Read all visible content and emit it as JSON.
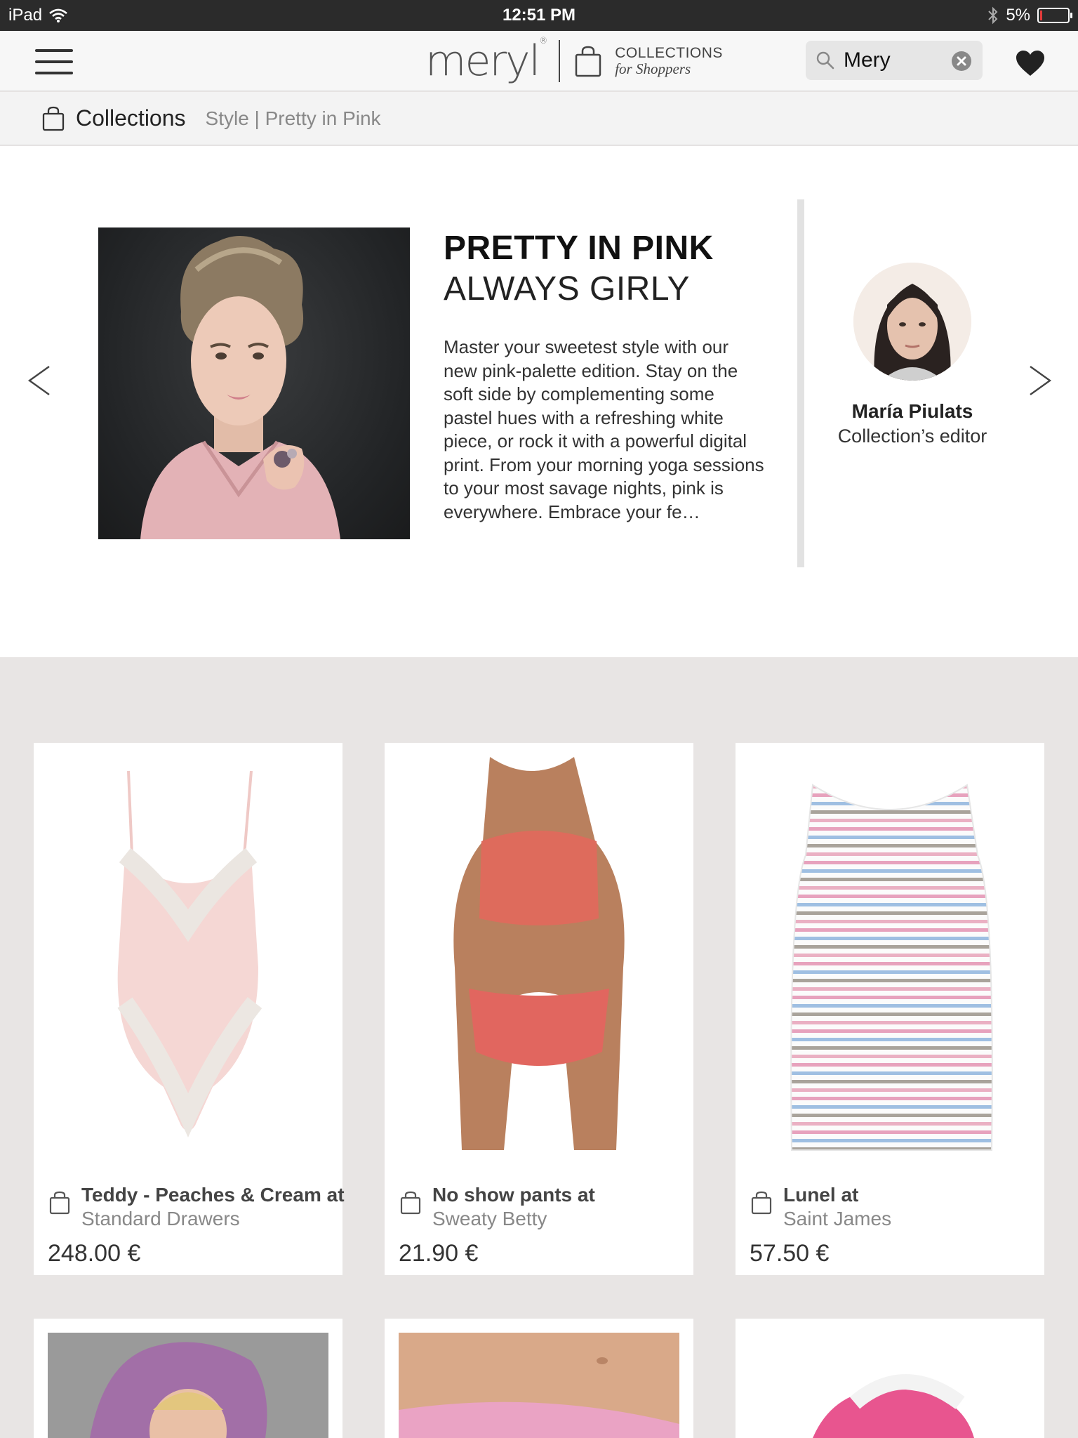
{
  "status_bar": {
    "device": "iPad",
    "time": "12:51 PM",
    "battery": "5%",
    "battery_level": 0.05
  },
  "navbar": {
    "brand": "meryl",
    "brand_line1": "COLLECTIONS",
    "brand_line2": "for Shoppers",
    "search_value": "Mery"
  },
  "breadcrumb": {
    "title": "Collections",
    "path": "Style | Pretty in Pink"
  },
  "hero": {
    "title": "PRETTY IN PINK",
    "subtitle": "ALWAYS GIRLY",
    "description": "Master your sweetest style with our new pink-palette edition. Stay on the soft side by complementing some pastel hues with a refreshing white piece, or rock it with a powerful digital print. From your morning yoga sessions to your most savage nights, pink is everywhere. Embrace your fe…",
    "editor_name": "María Piulats",
    "editor_role": "Collection’s editor"
  },
  "products": [
    {
      "name": "Teddy - Peaches & Cream at",
      "store": "Standard Drawers",
      "price": "248.00 €"
    },
    {
      "name": "No show pants at",
      "store": "Sweaty Betty",
      "price": "21.90 €"
    },
    {
      "name": "Lunel at",
      "store": "Saint James",
      "price": "57.50 €"
    }
  ],
  "colors": {
    "accent": "#e23b3b",
    "background": "#e8e5e4"
  }
}
